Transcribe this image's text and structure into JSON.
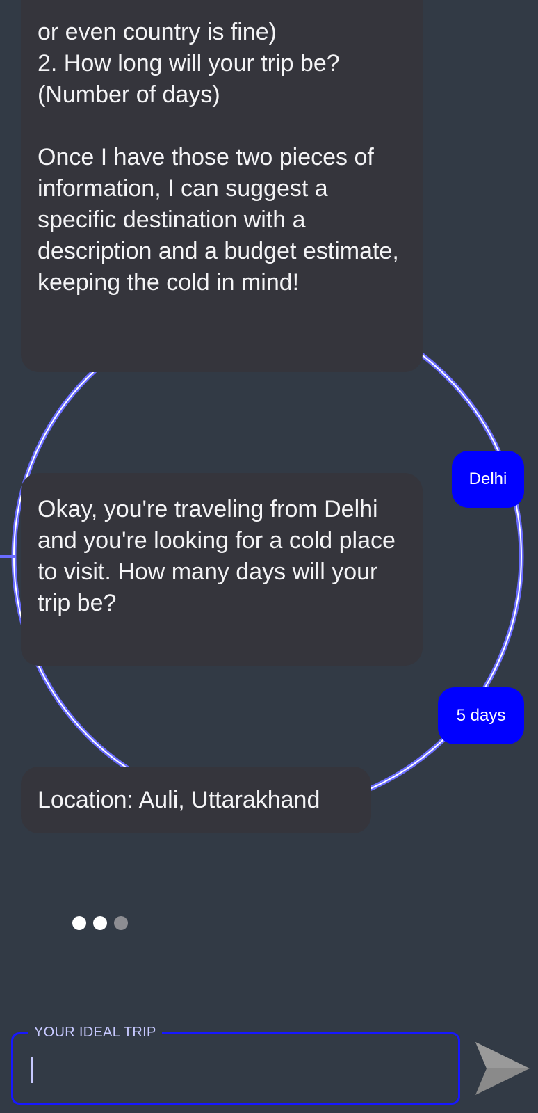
{
  "chat": {
    "messages": [
      {
        "role": "bot",
        "text": "or even country is fine)\n2. How long will your trip be?\n(Number of days)\n\nOnce I have those two pieces of information, I can suggest a specific destination with a description and a budget estimate, keeping the cold in mind!"
      },
      {
        "role": "user",
        "text": "Delhi"
      },
      {
        "role": "bot",
        "text": "Okay, you're traveling from Delhi and you're looking for a cold place to visit. How many days will your trip be?"
      },
      {
        "role": "user",
        "text": "5 days"
      },
      {
        "role": "bot",
        "text": "Location: Auli, Uttarakhand"
      }
    ],
    "typing_indicator": {
      "dots": 3,
      "active_dots": 2
    }
  },
  "input": {
    "label": "YOUR IDEAL TRIP",
    "value": ""
  },
  "send": {
    "icon": "send-icon"
  },
  "colors": {
    "background": "#323a45",
    "bot_bubble": "#35353c",
    "user_bubble": "#0000ff",
    "ring": "#6a6cff",
    "input_border": "#1717ff",
    "send_icon": "#8a8a8a"
  }
}
